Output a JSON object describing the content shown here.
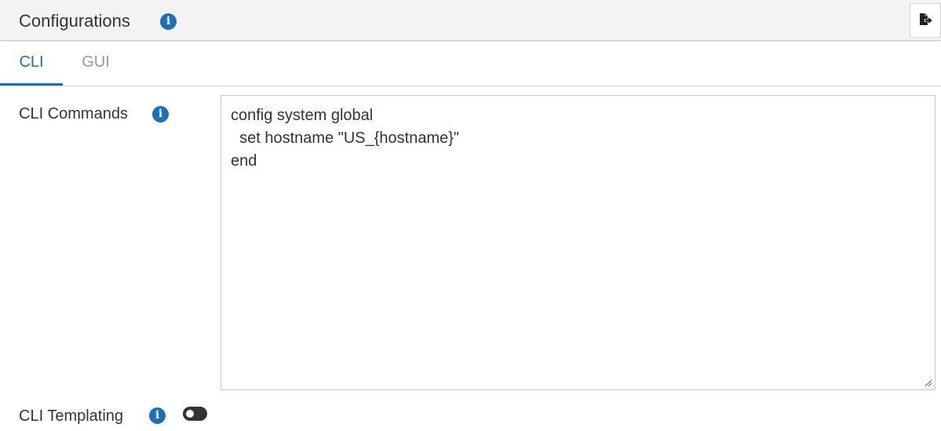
{
  "header": {
    "title": "Configurations",
    "info_icon": "info-circle-icon",
    "export_icon": "file-export-icon"
  },
  "tabs": [
    {
      "label": "CLI",
      "active": true
    },
    {
      "label": "GUI",
      "active": false
    }
  ],
  "cli_commands": {
    "label": "CLI Commands",
    "lines": [
      "config system global",
      "  set hostname \"US_{hostname}\"",
      "end"
    ]
  },
  "cli_templating": {
    "label": "CLI Templating",
    "enabled": false
  },
  "colors": {
    "accent": "#1f6fb5",
    "header_bg": "#f3f3f4",
    "toggle_off": "#333333",
    "inactive_tab": "#9a9a9a"
  }
}
